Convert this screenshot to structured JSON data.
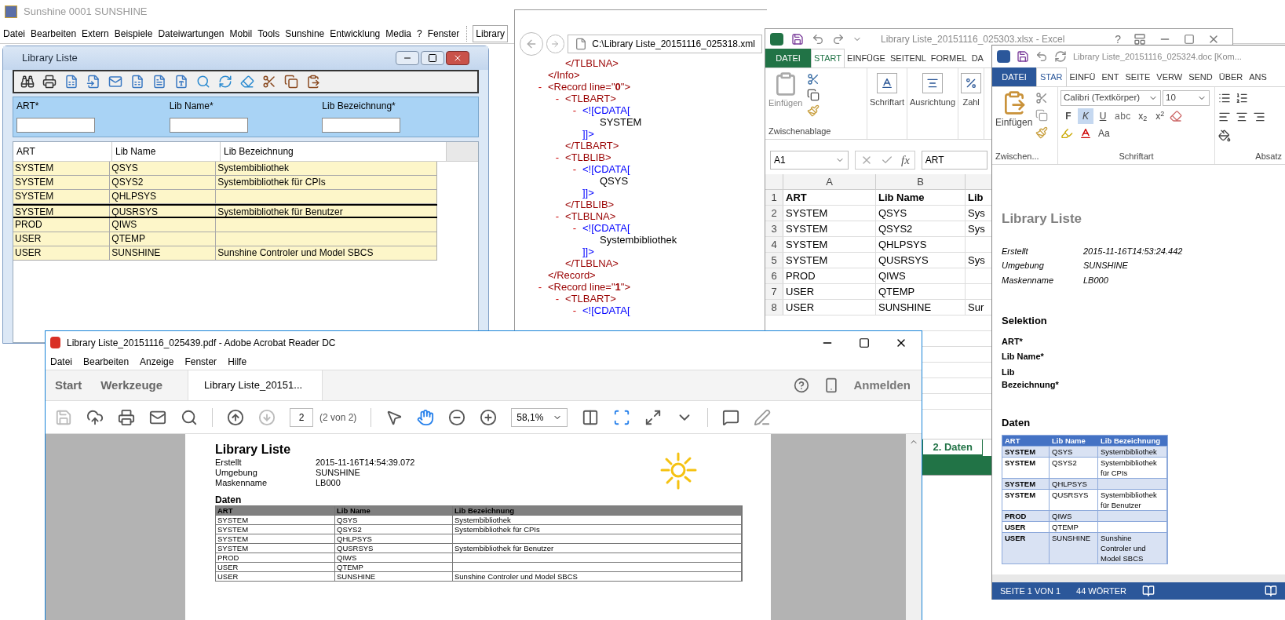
{
  "app": {
    "title": "Sunshine  0001 SUNSHINE",
    "menu": [
      "Datei",
      "Bearbeiten",
      "Extern",
      "Beispiele",
      "Dateiwartungen",
      "Mobil",
      "Tools",
      "Sunshine",
      "Entwicklung",
      "Media",
      "?",
      "Fenster"
    ],
    "window_menu": "Library"
  },
  "library_window": {
    "title": "Library Liste",
    "filters": [
      {
        "label": "ART*"
      },
      {
        "label": "Lib Name*"
      },
      {
        "label": "Lib Bezeichnung*"
      }
    ],
    "columns": [
      "ART",
      "Lib Name",
      "Lib Bezeichnung"
    ],
    "rows": [
      {
        "cells": [
          "SYSTEM",
          "QSYS",
          "Systembibliothek"
        ],
        "selected": false
      },
      {
        "cells": [
          "SYSTEM",
          "QSYS2",
          "Systembibliothek für CPIs"
        ],
        "selected": false
      },
      {
        "cells": [
          "SYSTEM",
          "QHLPSYS"
        ],
        "selected": false
      },
      {
        "cells": [
          "SYSTEM",
          "QUSRSYS",
          "Systembibliothek für Benutzer"
        ],
        "selected": true
      },
      {
        "cells": [
          "PROD",
          "QIWS"
        ],
        "selected": false
      },
      {
        "cells": [
          "USER",
          "QTEMP"
        ],
        "selected": false
      },
      {
        "cells": [
          "USER",
          "SUNSHINE",
          "Sunshine Controler und Model SBCS"
        ],
        "selected": false
      }
    ]
  },
  "xml_window": {
    "address": "C:\\Library Liste_20151116_025318.xml",
    "nodes": [
      {
        "kind": "tag",
        "end": "</Info>",
        "children": [
          {
            "kind": "tag",
            "end": "</TLBLNA>"
          }
        ]
      },
      {
        "kind": "tag",
        "toggle": "-",
        "text": "<Record line=\"**0**\">",
        "end": "</Record>",
        "children": [
          {
            "kind": "tag",
            "toggle": "-",
            "text": "<TLBART>",
            "end": "</TLBART>",
            "children": [
              {
                "kind": "cdata",
                "toggle": "-",
                "text": "<![CDATA[",
                "end": "]]>",
                "children": [
                  {
                    "kind": "value",
                    "text": "SYSTEM"
                  }
                ]
              }
            ]
          },
          {
            "kind": "tag",
            "toggle": "-",
            "text": "<TLBLIB>",
            "end": "</TLBLIB>",
            "children": [
              {
                "kind": "cdata",
                "toggle": "-",
                "text": "<![CDATA[",
                "end": "]]>",
                "children": [
                  {
                    "kind": "value",
                    "text": "QSYS"
                  }
                ]
              }
            ]
          },
          {
            "kind": "tag",
            "toggle": "-",
            "text": "<TLBLNA>",
            "end": "</TLBLNA>",
            "children": [
              {
                "kind": "cdata",
                "toggle": "-",
                "text": "<![CDATA[",
                "end": "]]>",
                "children": [
                  {
                    "kind": "value",
                    "text": "Systembibliothek"
                  }
                ]
              }
            ]
          }
        ]
      },
      {
        "kind": "tag",
        "toggle": "-",
        "text": "<Record line=\"**1**\">",
        "children": [
          {
            "kind": "tag",
            "toggle": "-",
            "text": "<TLBART>",
            "children": [
              {
                "kind": "cdata",
                "toggle": "-",
                "text": "<![CDATA["
              }
            ]
          }
        ]
      }
    ]
  },
  "excel_window": {
    "title": "Library Liste_20151116_025303.xlsx - Excel",
    "help": "?",
    "tabs": [
      {
        "label": "DATEI",
        "kind": "file",
        "selected": false
      },
      {
        "label": "START",
        "kind": "tab",
        "selected": true
      },
      {
        "label": "EINFÜGE",
        "kind": "tab",
        "selected": false
      },
      {
        "label": "SEITENL",
        "kind": "tab",
        "selected": false
      },
      {
        "label": "FORMEL",
        "kind": "tab",
        "selected": false
      },
      {
        "label": "DA",
        "kind": "tab",
        "selected": false
      }
    ],
    "paste": "Einfügen",
    "clipboard_group": "Zwischenablage",
    "ribbon_buttons": [
      {
        "label": "Schriftart",
        "kind": "font"
      },
      {
        "label": "Ausrichtung",
        "kind": "align"
      },
      {
        "label": "Zahl",
        "kind": "number"
      }
    ],
    "name_box": "A1",
    "function_label": "fx",
    "formula": "ART",
    "column_letters": [
      "A",
      "B"
    ],
    "rows": [
      {
        "number": "1",
        "kind": "header",
        "cells": [
          "ART",
          "Lib Name",
          "Lib"
        ]
      },
      {
        "number": "2",
        "kind": "data",
        "cells": [
          "SYSTEM",
          "QSYS",
          "Sys"
        ]
      },
      {
        "number": "3",
        "kind": "data",
        "cells": [
          "SYSTEM",
          "QSYS2",
          "Sys"
        ]
      },
      {
        "number": "4",
        "kind": "data",
        "cells": [
          "SYSTEM",
          "QHLPSYS"
        ]
      },
      {
        "number": "5",
        "kind": "data",
        "cells": [
          "SYSTEM",
          "QUSRSYS",
          "Sys"
        ]
      },
      {
        "number": "6",
        "kind": "data",
        "cells": [
          "PROD",
          "QIWS"
        ]
      },
      {
        "number": "7",
        "kind": "data",
        "cells": [
          "USER",
          "QTEMP"
        ]
      },
      {
        "number": "8",
        "kind": "data",
        "cells": [
          "USER",
          "SUNSHINE",
          "Sur"
        ]
      }
    ],
    "sheet_tab": "2. Daten"
  },
  "word_window": {
    "title": "Library Liste_20151116_025324.doc [Kom...",
    "tabs": [
      {
        "label": "DATEI",
        "kind": "file",
        "selected": false
      },
      {
        "label": "STAR",
        "kind": "tab",
        "selected": true
      },
      {
        "label": "EINFÜ",
        "kind": "tab",
        "selected": false
      },
      {
        "label": "ENT",
        "kind": "tab",
        "selected": false
      },
      {
        "label": "SEITE",
        "kind": "tab",
        "selected": false
      },
      {
        "label": "VERW",
        "kind": "tab",
        "selected": false
      },
      {
        "label": "SEND",
        "kind": "tab",
        "selected": false
      },
      {
        "label": "ÜBER",
        "kind": "tab",
        "selected": false
      },
      {
        "label": "ANS",
        "kind": "tab",
        "selected": false
      }
    ],
    "paste": "Einfügen",
    "font": "Calibri (Textkörper)",
    "font_size": "10",
    "format_buttons": [
      {
        "label": "F",
        "kind": "bold",
        "selected": false
      },
      {
        "label": "K",
        "kind": "italic",
        "selected": true
      },
      {
        "label": "U",
        "kind": "underline",
        "selected": false
      },
      {
        "label": "abc",
        "kind": "strike",
        "selected": false
      },
      {
        "label": "x$_{2}$",
        "kind": "plain",
        "selected": false
      },
      {
        "label": "x$^{2}$",
        "kind": "plain",
        "selected": false
      }
    ],
    "case_button": "Aa",
    "groups": [
      "Zwischen...",
      "Schriftart",
      "Absatz"
    ],
    "document": {
      "title": "Library Liste",
      "meta": [
        {
          "label": "Erstellt",
          "value": "2015-11-16T14:53:24.442"
        },
        {
          "label": "Umgebung",
          "value": "SUNSHINE"
        },
        {
          "label": "Maskenname",
          "value": "LB000"
        }
      ],
      "selection_heading": "Selektion",
      "selection": [
        "ART*",
        "Lib Name*",
        "Lib Bezeichnung*"
      ],
      "data_heading": "Daten",
      "columns": [
        "ART",
        "Lib Name",
        "Lib Bezeichnung"
      ],
      "rows": [
        [
          "SYSTEM",
          "QSYS",
          "Systembibliothek"
        ],
        [
          "SYSTEM",
          "QSYS2",
          "Systembibliothek für CPIs"
        ],
        [
          "SYSTEM",
          "QHLPSYS"
        ],
        [
          "SYSTEM",
          "QUSRSYS",
          "Systembibliothek für Benutzer"
        ],
        [
          "PROD",
          "QIWS"
        ],
        [
          "USER",
          "QTEMP"
        ],
        [
          "USER",
          "SUNSHINE",
          "Sunshine Controler und Model SBCS"
        ]
      ]
    },
    "status": [
      "SEITE 1 VON 1",
      "44 WÖRTER"
    ]
  },
  "pdf_window": {
    "title": "Library Liste_20151116_025439.pdf - Adobe Acrobat Reader DC",
    "menu": [
      "Datei",
      "Bearbeiten",
      "Anzeige",
      "Fenster",
      "Hilfe"
    ],
    "nav": [
      "Start",
      "Werkzeuge"
    ],
    "doc_tab": "Library Liste_20151...",
    "sign_in": "Anmelden",
    "page": "2",
    "page_count": "(2 von 2)",
    "zoom": "58,1%",
    "document": {
      "title": "Library Liste",
      "meta": [
        {
          "label": "Erstellt",
          "value": "2015-11-16T14:54:39.072"
        },
        {
          "label": "Umgebung",
          "value": "SUNSHINE"
        },
        {
          "label": "Maskenname",
          "value": "LB000"
        }
      ],
      "data_heading": "Daten",
      "columns": [
        "ART",
        "Lib Name",
        "Lib Bezeichnung"
      ],
      "rows": [
        [
          "SYSTEM",
          "QSYS",
          "Systembibliothek"
        ],
        [
          "SYSTEM",
          "QSYS2",
          "Systembibliothek für CPIs"
        ],
        [
          "SYSTEM",
          "QHLPSYS"
        ],
        [
          "SYSTEM",
          "QUSRSYS",
          "Systembibliothek für Benutzer"
        ],
        [
          "PROD",
          "QIWS"
        ],
        [
          "USER",
          "QTEMP"
        ],
        [
          "USER",
          "SUNSHINE",
          "Sunshine Controler und Model SBCS"
        ]
      ]
    }
  }
}
